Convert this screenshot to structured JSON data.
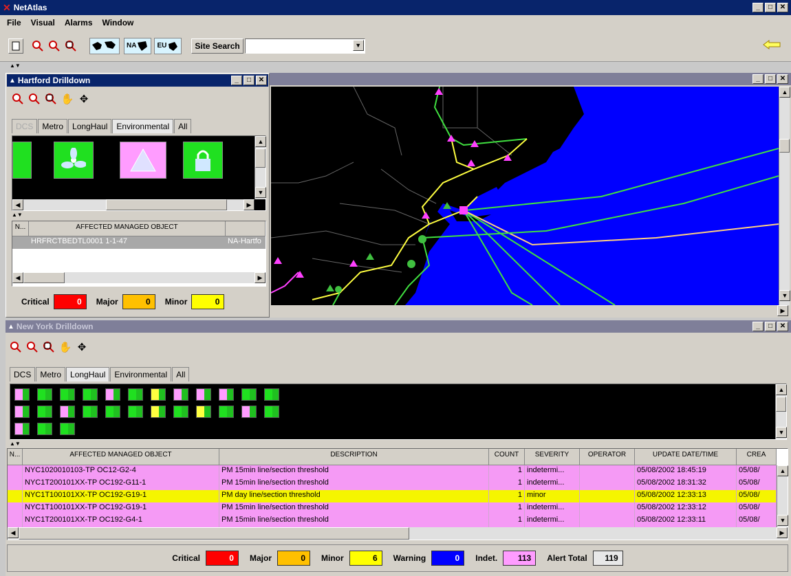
{
  "app": {
    "title": "NetAtlas"
  },
  "menu": [
    "File",
    "Visual",
    "Alarms",
    "Window"
  ],
  "toolbar": {
    "region_na": "NA",
    "region_eu": "EU",
    "site_search_label": "Site Search",
    "site_search_value": ""
  },
  "hartford": {
    "title": "Hartford Drilldown",
    "tabs": [
      "DCS",
      "Metro",
      "LongHaul",
      "Environmental",
      "All"
    ],
    "active_tab": "Environmental",
    "table_headers": [
      "N...",
      "AFFECTED MANAGED OBJECT"
    ],
    "row": {
      "object": "HRFRCTBEDTL0001 1-1-47",
      "site": "NA-Hartfo"
    },
    "counters": {
      "critical_label": "Critical",
      "critical": "0",
      "major_label": "Major",
      "major": "0",
      "minor_label": "Minor",
      "minor": "0"
    }
  },
  "newyork": {
    "title": "New York Drilldown",
    "tabs": [
      "DCS",
      "Metro",
      "LongHaul",
      "Environmental",
      "All"
    ],
    "active_tab": "LongHaul",
    "table_headers": [
      "N...",
      "AFFECTED MANAGED OBJECT",
      "DESCRIPTION",
      "COUNT",
      "SEVERITY",
      "OPERATOR",
      "UPDATE DATE/TIME",
      "CREA"
    ],
    "rows": [
      {
        "object": "NYC1020010103-TP  OC12-G2-4",
        "description": "PM 15min line/section threshold",
        "count": "1",
        "severity": "indetermi...",
        "operator": "",
        "updated": "05/08/2002  18:45:19",
        "created": "05/08/",
        "color": "#f59af5"
      },
      {
        "object": "NYC1T200101XX-TP  OC192-G11-1",
        "description": "PM 15min line/section threshold",
        "count": "1",
        "severity": "indetermi...",
        "operator": "",
        "updated": "05/08/2002  18:31:32",
        "created": "05/08/",
        "color": "#f59af5"
      },
      {
        "object": "NYC1T100101XX-TP  OC192-G19-1",
        "description": "PM day line/section threshold",
        "count": "1",
        "severity": "minor",
        "operator": "",
        "updated": "05/08/2002  12:33:13",
        "created": "05/08/",
        "color": "#f5f500"
      },
      {
        "object": "NYC1T100101XX-TP  OC192-G19-1",
        "description": "PM 15min line/section threshold",
        "count": "1",
        "severity": "indetermi...",
        "operator": "",
        "updated": "05/08/2002  12:33:12",
        "created": "05/08/",
        "color": "#f59af5"
      },
      {
        "object": "NYC1T200101XX-TP  OC192-G4-1",
        "description": "PM 15min line/section threshold",
        "count": "1",
        "severity": "indetermi...",
        "operator": "",
        "updated": "05/08/2002  12:33:11",
        "created": "05/08/",
        "color": "#f59af5"
      }
    ],
    "counters": {
      "critical_label": "Critical",
      "critical": "0",
      "major_label": "Major",
      "major": "0",
      "minor_label": "Minor",
      "minor": "6",
      "warning_label": "Warning",
      "warning": "0",
      "indet_label": "Indet.",
      "indet": "113",
      "total_label": "Alert Total",
      "total": "119"
    }
  },
  "colors": {
    "critical": "#ff0000",
    "major": "#ffc000",
    "minor": "#ffff00",
    "warning": "#0000ff",
    "indet": "#ff9cff",
    "ocean": "#0000ff",
    "land": "#000000"
  }
}
